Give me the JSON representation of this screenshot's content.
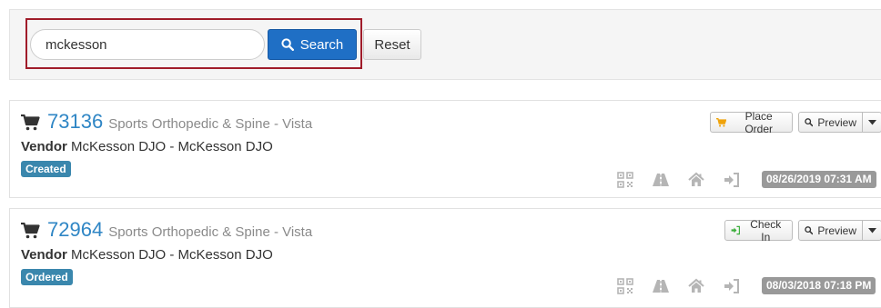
{
  "search": {
    "value": "mckesson",
    "button_label": "Search",
    "reset_label": "Reset"
  },
  "orders": [
    {
      "number": "73136",
      "location": "Sports Orthopedic & Spine - Vista",
      "vendor_label": "Vendor",
      "vendor_name": "McKesson DJO - McKesson DJO",
      "status": "Created",
      "primary_action": "Place Order",
      "preview_label": "Preview",
      "date": "08/26/2019 07:31 AM"
    },
    {
      "number": "72964",
      "location": "Sports Orthopedic & Spine - Vista",
      "vendor_label": "Vendor",
      "vendor_name": "McKesson DJO - McKesson DJO",
      "status": "Ordered",
      "primary_action": "Check In",
      "preview_label": "Preview",
      "date": "08/03/2018 07:18 PM"
    }
  ],
  "colors": {
    "primary_button": "#1f6fc5",
    "link_blue": "#2f86c5",
    "status_badge": "#3a87ad",
    "date_badge": "#999999",
    "highlight_border": "#a01c2a",
    "cart_icon_place": "#f0a30a",
    "check_in_icon": "#3cae3c"
  },
  "icons": {
    "cart": "shopping-cart-icon",
    "search": "magnifier-icon",
    "qr": "qr-code-icon",
    "road": "road-icon",
    "home": "home-icon",
    "login": "sign-in-icon",
    "caret": "caret-down-icon"
  }
}
